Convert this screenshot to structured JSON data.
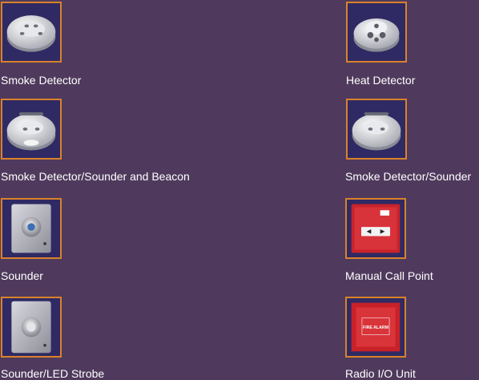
{
  "colors": {
    "background": "#4f3a5d",
    "thumb_border": "#d9822b",
    "thumb_background": "#2f2a63",
    "label_text": "#ffffff"
  },
  "products": [
    {
      "label": "Smoke Detector",
      "icon": "smoke-detector-icon"
    },
    {
      "label": "Heat Detector",
      "icon": "heat-detector-icon"
    },
    {
      "label": "Smoke Detector/Sounder and Beacon",
      "icon": "smoke-detector-sounder-beacon-icon"
    },
    {
      "label": "Smoke Detector/Sounder",
      "icon": "smoke-detector-sounder-icon"
    },
    {
      "label": "Sounder",
      "icon": "sounder-icon"
    },
    {
      "label": "Manual Call Point",
      "icon": "manual-call-point-icon"
    },
    {
      "label": "Sounder/LED Strobe",
      "icon": "sounder-led-strobe-icon"
    },
    {
      "label": "Radio I/O Unit",
      "icon": "radio-io-unit-icon",
      "panel_text": "FIRE ALARM"
    }
  ]
}
